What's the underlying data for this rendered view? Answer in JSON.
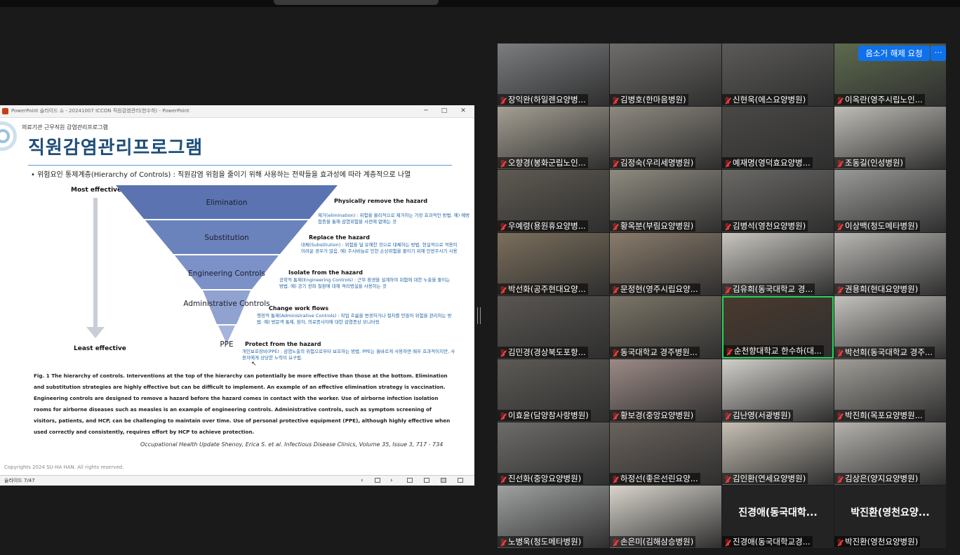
{
  "ppt": {
    "window_title": "PowerPoint 슬라이드 쇼  -  20241007 ICCON 직원감염관리(한수하) - PowerPoint",
    "status_slide": "슬라이드 7/47"
  },
  "slide": {
    "subtitle": "의료기관 근무직원 감염관리프로그램",
    "title": "직원감염관리프로그램",
    "bullet": "• 위험요인 통제계층(Hierarchy of Controls) : 직원감염 위험을 줄이기 위해 사용하는 전략들을 효과성에 따라 계층적으로 나열",
    "most_effective": "Most effective",
    "least_effective": "Least effective",
    "levels": [
      {
        "label": "Elimination",
        "head": "Physically remove the hazard",
        "desc": "제거(elimination) : 위험을 물리적으로 제거하는 가장 효과적인 방법. 예) 예방접종을 통해 감염위험을 사전에 없애는 것"
      },
      {
        "label": "Substitution",
        "head": "Replace the hazard",
        "desc": "대체(Substitution) : 위험을 덜 유해한 것으로 대체하는 방법. 현실적으로 적용이 어려운 경우가 많음. 예) 주사바늘로 인한 손상위험을 줄이기 위해 안전주사기 사용"
      },
      {
        "label": "Engineering Controls",
        "head": "Isolate from the hazard",
        "desc": "공학적 통제(Engineering Controls) : 근무 환경을 설계하여 위험에 대한 노출을 줄이는 방법. 예) 공기 전파 질환에 대해 격리병실을 사용하는 것"
      },
      {
        "label": "Administrative Controls",
        "head": "Change work flows",
        "desc": "행정적 통제(Administrative Controls) : 작업 흐름을 변경하거나 절차를 만들어 위험을 관리하는 방법. 예) 방문객 통제, 환자, 의료종사자에 대한 감염증상 모니터링"
      },
      {
        "label": "PPE",
        "head": "Protect from the hazard",
        "desc": "개인보호장비(PPE) : 감염노출의 위험으로부터 보호하는 방법. PPE는 올바르게 사용하면 매우 효과적이지만, 사용자에게 상당한 노력이 요구됨."
      }
    ],
    "caption_prefix": "Fig. 1",
    "caption": "The hierarchy of controls. Interventions at the top of the hierarchy can potentially be more effective than those at the bottom. Elimination and substitution strategies are highly effective but can be difficult to implement. An example of an effective elimination strategy is vaccination. Engineering controls are designed to remove a hazard before the hazard comes in contact with the worker. Use of airborne infection isolation rooms for airborne diseases such as measles is an example of engineering controls. Administrative controls, such as symptom screening of visitors, patients, and HCP, can be challenging to maintain over time. Use of personal protective equipment (PPE), although highly effective when used correctly and consistently, requires effort by HCP to achieve protection.",
    "reference": "Occupational Health Update Shenoy, Erica S. et al. Infectious Disease Clinics, Volume 35, Issue 3, 717 - 734",
    "copyright": "Copyrights 2024 SU-HA HAN. All rights reserved."
  },
  "gallery": {
    "unmute_request": "음소거 해제 요청",
    "more": "⋯",
    "participants": [
      {
        "name": "장익완(하일렌요양병...",
        "scene": "#7b7d80"
      },
      {
        "name": "김병호(한마음병원)",
        "scene": "#6f6d6a"
      },
      {
        "name": "신현욱(에스요양병원)",
        "scene": "#5b5a58"
      },
      {
        "name": "이옥란(영주시립노인...",
        "scene": "#5d6a4e"
      },
      {
        "name": "오향경(봉화군립노인...",
        "scene": "#a59f93"
      },
      {
        "name": "김정숙(우리세명병원)",
        "scene": "#8e8980"
      },
      {
        "name": "예재명(영덕효요양병...",
        "scene": "#4a4846"
      },
      {
        "name": "조동길(인성병원)",
        "scene": "#bfbdb6"
      },
      {
        "name": "우예령(용원휴요양병...",
        "scene": "#5f5a52"
      },
      {
        "name": "황옥분(부림요양병원)",
        "scene": "#8f8b80"
      },
      {
        "name": "김병석(영천요양병원)",
        "scene": "#6a6865"
      },
      {
        "name": "이상백(청도메타병원)",
        "scene": "#9a9a98"
      },
      {
        "name": "박선화(공주현대요양...",
        "scene": "#7b6f5c"
      },
      {
        "name": "문정현(영주시립요양...",
        "scene": "#8a7c6c"
      },
      {
        "name": "김유희(동국대학교 경...",
        "scene": "#c9c6c0"
      },
      {
        "name": "권용희(현대요양병원)",
        "scene": "#b8b7b3"
      },
      {
        "name": "김민경(경상북도포항...",
        "scene": "#5a5652"
      },
      {
        "name": "동국대학교 경주병원...",
        "scene": "#7c7567"
      },
      {
        "name": "순천향대학교 한수하(대...",
        "scene": "#4a3a2e"
      },
      {
        "name": "박선희(동국대학교 경주...",
        "scene": "#c4c2bd"
      },
      {
        "name": "이효윤(담양참사랑병원)",
        "scene": "#5d5a55"
      },
      {
        "name": "황보경(중앙요양병원)",
        "scene": "#9b8a86"
      },
      {
        "name": "김난영(서광병원)",
        "scene": "#d1cfca"
      },
      {
        "name": "박진희(목포요양병원...",
        "scene": "#a09d97"
      },
      {
        "name": "진선화(중앙요양병원)",
        "scene": "#6e6c6a"
      },
      {
        "name": "하정선(좋은선린요양...",
        "scene": "#6a625c"
      },
      {
        "name": "김인환(연세요양병원)",
        "scene": "#c7c0b4"
      },
      {
        "name": "김상은(양지요양병원)",
        "scene": "#b5b2ad"
      },
      {
        "name": "노병욱(청도메타병원)",
        "scene": "#9fa2a0"
      },
      {
        "name": "손은미(김해삼승병원)",
        "scene": "#d9d5cd"
      },
      {
        "name": "진경애(동국대학교경...",
        "scene": "",
        "big": "진경애(동국대학..."
      },
      {
        "name": "박진환(영천요양병원)",
        "scene": "",
        "big": "박진환(영천요양..."
      }
    ]
  }
}
